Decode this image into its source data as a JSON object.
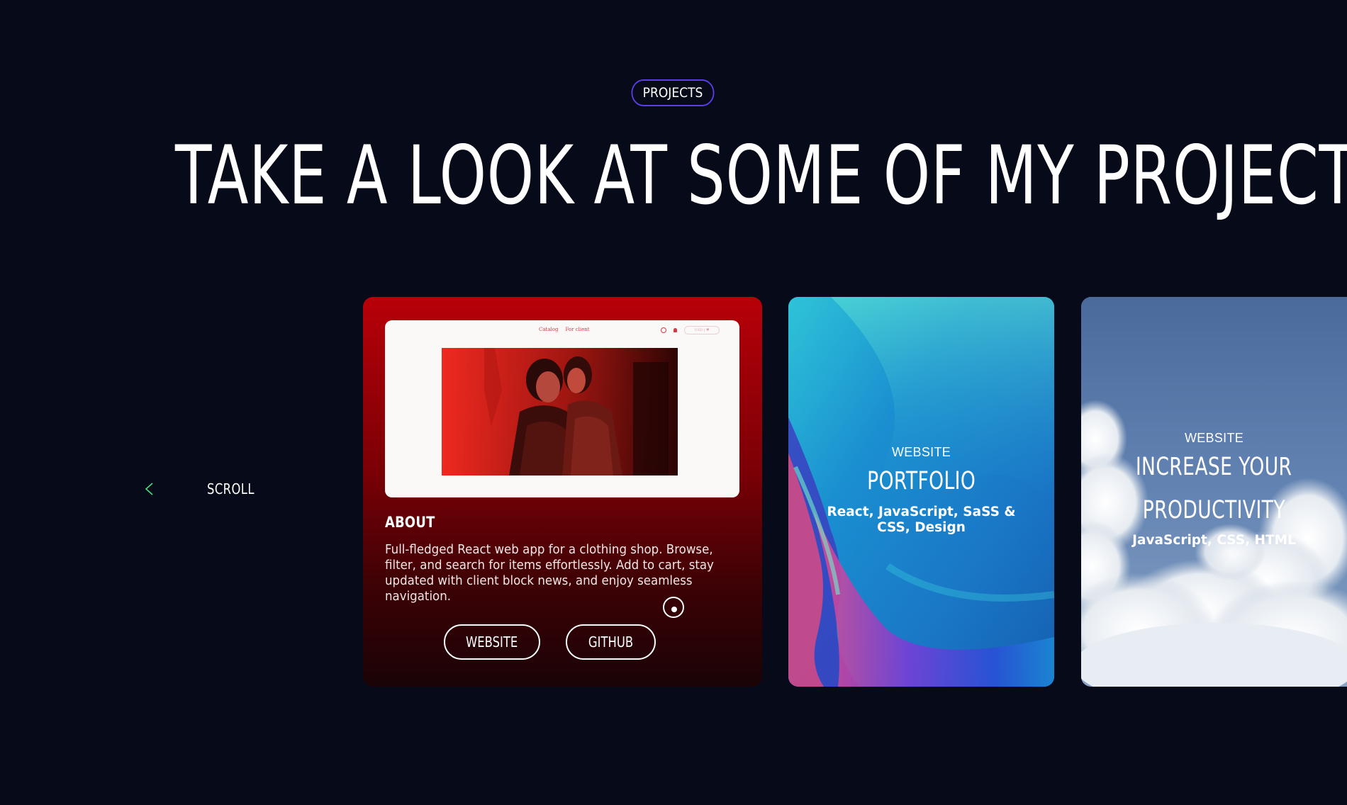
{
  "section_badge": "PROJECTS",
  "title": "TAKE A LOOK AT SOME OF MY PROJECTS",
  "scroll_label": "SCROLL",
  "colors": {
    "background": "#060a19",
    "badge_border": "#5b3dea",
    "scroll_arrow": "#4ade80"
  },
  "projects": [
    {
      "preview": {
        "nav_links": [
          "Catalog",
          "For client"
        ],
        "cart_pill": "USD | ♥"
      },
      "heading": "ABOUT",
      "description": "Full-fledged React web app for a clothing shop. Browse, filter, and search for items effortlessly. Add to cart, stay updated with client block news, and enjoy seamless navigation.",
      "buttons": [
        "WEBSITE",
        "GITHUB"
      ]
    },
    {
      "eyebrow": "WEBSITE",
      "title": "PORTFOLIO",
      "tech": "React, JavaScript, SaSS & CSS, Design"
    },
    {
      "eyebrow": "WEBSITE",
      "title_line1": "INCREASE YOUR",
      "title_line2": "PRODUCTIVITY",
      "tech": "JavaScript, CSS, HTML"
    }
  ]
}
